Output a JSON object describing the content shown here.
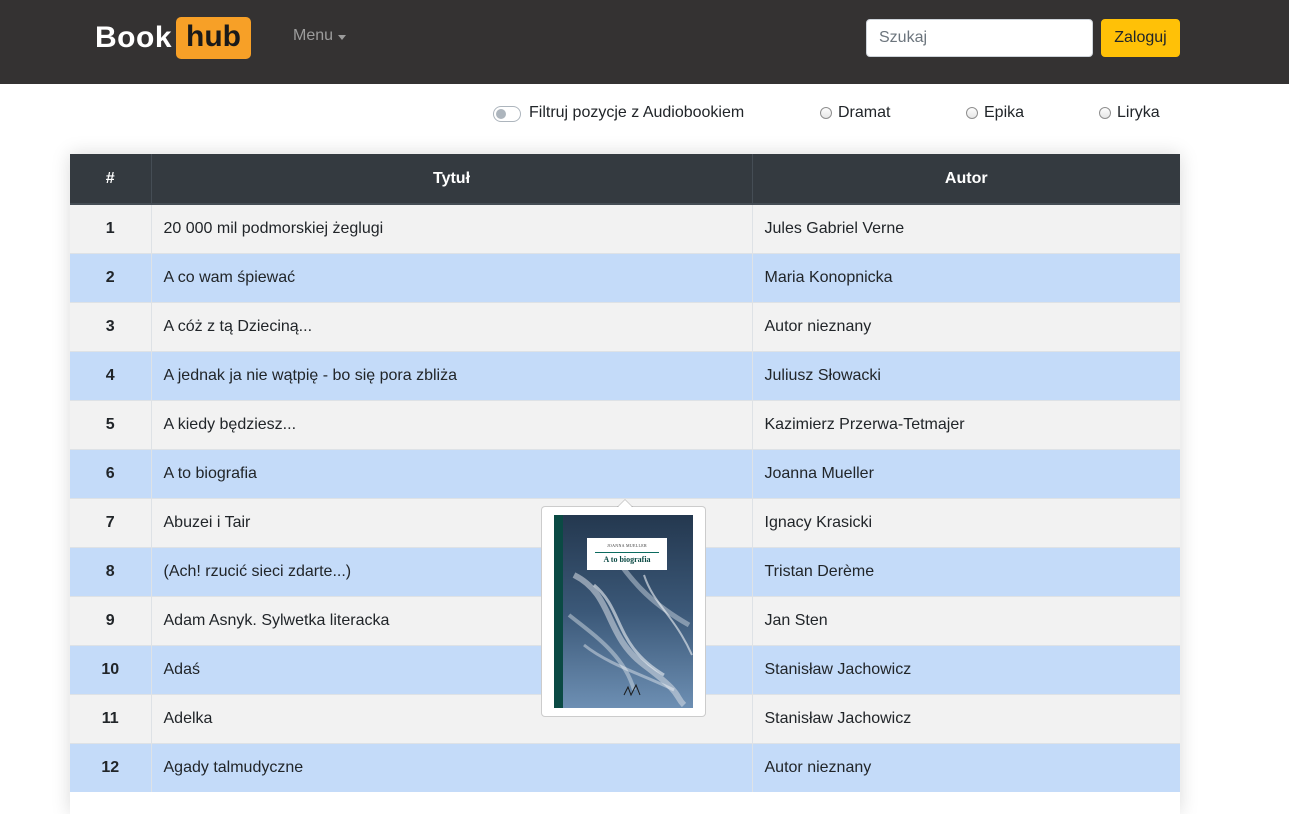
{
  "navbar": {
    "brand_part1": "Book",
    "brand_part2": "hub",
    "menu_label": "Menu",
    "search_placeholder": "Szukaj",
    "login_label": "Zaloguj"
  },
  "filters": {
    "audiobook_toggle_label": "Filtruj pozycje z Audiobookiem",
    "audiobook_toggle_on": false,
    "genres": [
      "Dramat",
      "Epika",
      "Liryka"
    ],
    "selected_genre": null
  },
  "table": {
    "headers": [
      "#",
      "Tytuł",
      "Autor"
    ],
    "rows": [
      {
        "num": "1",
        "title": "20 000 mil podmorskiej żeglugi",
        "author": "Jules Gabriel Verne"
      },
      {
        "num": "2",
        "title": "A co wam śpiewać",
        "author": "Maria Konopnicka"
      },
      {
        "num": "3",
        "title": "A cóż z tą Dzieciną...",
        "author": "Autor nieznany"
      },
      {
        "num": "4",
        "title": "A jednak ja nie wątpię - bo się pora zbliża",
        "author": "Juliusz Słowacki"
      },
      {
        "num": "5",
        "title": "A kiedy będziesz...",
        "author": "Kazimierz Przerwa-Tetmajer"
      },
      {
        "num": "6",
        "title": "A to biografia",
        "author": "Joanna Mueller"
      },
      {
        "num": "7",
        "title": "Abuzei i Tair",
        "author": "Ignacy Krasicki"
      },
      {
        "num": "8",
        "title": "(Ach! rzucić sieci zdarte...)",
        "author": "Tristan Derème"
      },
      {
        "num": "9",
        "title": "Adam Asnyk. Sylwetka literacka",
        "author": "Jan Sten"
      },
      {
        "num": "10",
        "title": "Adaś",
        "author": "Stanisław Jachowicz"
      },
      {
        "num": "11",
        "title": "Adelka",
        "author": "Stanisław Jachowicz"
      },
      {
        "num": "12",
        "title": "Agady talmudyczne",
        "author": "Autor nieznany"
      }
    ]
  },
  "popover": {
    "cover_author": "JOANNA MUELLER",
    "cover_title": "A to biografia"
  },
  "colors": {
    "navbar_bg": "#343232",
    "brand_accent": "#f7a027",
    "login_button": "#ffc107",
    "table_header_bg": "#343a40",
    "row_odd": "#f2f2f2",
    "row_even": "#c4dbf9"
  }
}
